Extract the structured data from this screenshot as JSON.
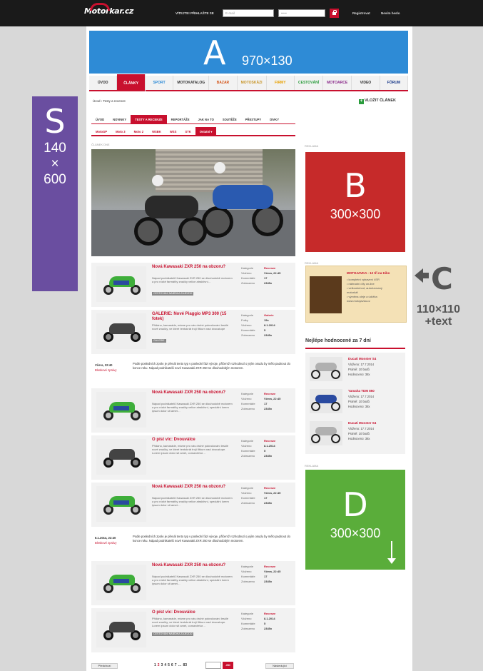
{
  "topbar": {
    "logo": "Motorkar.cz",
    "login_label": "VÍTEJTE! PŘIHLAŠTE SE",
    "email_placeholder": "E-mail",
    "password_placeholder": "•••••",
    "register": "Registrovat",
    "forgot": "Nevím heslo"
  },
  "ads": {
    "a": {
      "letter": "A",
      "dim": "970×130"
    },
    "s": {
      "letter": "S",
      "dim1": "140",
      "dim2": "×",
      "dim3": "600"
    },
    "b": {
      "label": "REKLAMA",
      "letter": "B",
      "dim": "300×300"
    },
    "c": {
      "label": "REKLAMA",
      "title": "MOTOJAVKA - 12 tři na triko",
      "lines": [
        "• kompletní vybavení 4SR",
        "• náhradní díly on-line",
        "• velkoobchod, autorizovaný",
        "  motorkář",
        "• výměna oleje a údržba",
        "www.motojavka.cz"
      ],
      "annot_letter": "C",
      "annot_dim1": "110×110",
      "annot_dim2": "+text"
    },
    "d": {
      "label": "REKLAMA",
      "letter": "D",
      "dim": "300×300"
    }
  },
  "mainnav": [
    "ÚVOD",
    "ČLÁNKY",
    "SPORT",
    "MOTOKATALOG",
    "BAZAR",
    "MOTOSKÁZI",
    "FIRMY",
    "CESTOVÁNÍ",
    "MOTOARCE",
    "VIDEO",
    "FÓRUM"
  ],
  "mainnav_colors": [
    "#333",
    "#fff",
    "#2e8bd6",
    "#333",
    "#d4561a",
    "#c8962a",
    "#e8a000",
    "#2a9c3c",
    "#8a2a8a",
    "#333",
    "#1a3a8a"
  ],
  "breadcrumb": "Úvod  ›  Testy a recenze",
  "add_article": "VLOŽIT ČLÁNEK",
  "subnav": [
    "ÚVOD",
    "NOVINKY",
    "TESTY A RECENZE",
    "REPORTÁŽE",
    "JAK NA TO",
    "SOUTĚŽE",
    "PŘESTUPY",
    "DIVKY"
  ],
  "subsubnav": [
    "MotoGP",
    "Moto 3",
    "Moto 2",
    "WSBK",
    "WSS",
    "STK",
    "Ostatní  ▾"
  ],
  "main_label": "ČLÁNEK DNE",
  "articles": [
    {
      "kind": "full",
      "moto": "green",
      "title": "Nová Kawasaki ZXR 250 na obzoru?",
      "perex": "Nápad podnikatelů Kawasaki ZXR 250 se dlouhodobě motorem a pro nízké farmářky značky velice atraktivní…",
      "tag": "CESTOVÁNÍ NABÍDKA ZÁJEZDŮ",
      "meta": [
        [
          "Kategorie",
          "Recenze"
        ],
        [
          "Vloženo",
          "Včera, 22:45"
        ],
        [
          "Komentáře",
          "17"
        ],
        [
          "Zobrazeno",
          "2345x"
        ]
      ]
    },
    {
      "kind": "full",
      "moto": "dark",
      "title": "GALERIE: Nové Piaggio MP3 300 (15 fotek)",
      "perex": "Přidáno, kamaráde, máme pro vás druhé pokračování lesklé nové značky, ve které tentokrát trojí fitkurn nad dvoustupe",
      "tag": "GALERIE",
      "meta": [
        [
          "Kategorie",
          "Galerie"
        ],
        [
          "Fotky",
          "15x"
        ],
        [
          "Vloženo",
          "8.1.2014"
        ],
        [
          "Komentáře",
          "5"
        ],
        [
          "Zobrazeno",
          "2345x"
        ]
      ]
    },
    {
      "kind": "short",
      "date": "Včera, 22:40",
      "link": "Bleskové zprávy",
      "text": "Podle posledních zpráv je přenál tento typ v poslední fázi vývoje, přičemž rozhodnutí o jejím osudu by mělo padnout do konce roku. Nápad podnikatelů nové Kawasaki ZXR 250 se dlouhodobým motorem."
    },
    {
      "kind": "full",
      "moto": "green",
      "title": "Nová Kawasaki ZXR 250 na obzoru?",
      "perex": "Nápad podnikatelů Kawasaki ZXR 250 se dlouhodobě motorem a pro nízké farmářky značky velice atraktivní, speciální lorem ipsum dolor sit amet…",
      "tag": "",
      "meta": [
        [
          "Kategorie",
          "Recenze"
        ],
        [
          "Vloženo",
          "Včera, 22:45"
        ],
        [
          "Komentáře",
          "17"
        ],
        [
          "Zobrazeno",
          "2345x"
        ]
      ]
    },
    {
      "kind": "full",
      "moto": "dark",
      "title": "O píst víc: Dvouválce",
      "perex": "Přidáno, kamaráde, máme pro vás druhé pokračování lesklé nové značky, ve které tentokrát trojí fitkurn nad dvoustupe. Lorem ipsum dolor sit amet, consectetur…",
      "tag": "",
      "meta": [
        [
          "Kategorie",
          "Recenze"
        ],
        [
          "Vloženo",
          "8.1.2014"
        ],
        [
          "Komentáře",
          "5"
        ],
        [
          "Zobrazeno",
          "2345x"
        ]
      ]
    },
    {
      "kind": "full",
      "moto": "green",
      "title": "Nová Kawasaki ZXR 250 na obzoru?",
      "perex": "Nápad podnikatelů Kawasaki ZXR 250 se dlouhodobě motorem a pro nízké farmářky značky velice atraktivní, speciální lorem ipsum dolor sit amet…",
      "tag": "",
      "meta": [
        [
          "Kategorie",
          "Recenze"
        ],
        [
          "Vloženo",
          "Včera, 22:45"
        ],
        [
          "Komentáře",
          "17"
        ],
        [
          "Zobrazeno",
          "2345x"
        ]
      ]
    },
    {
      "kind": "short",
      "date": "8.1.2014, 22:40",
      "link": "Bleskové zprávy",
      "text": "Podle posledních zpráv je přenál tento typ v poslední fázi vývoje, přičemž rozhodnutí o jejím osudu by mělo padnout do konce roku. Nápad podnikatelů nové Kawasaki ZXR 250 se dlouhodobým motorem."
    },
    {
      "kind": "full",
      "moto": "green",
      "title": "Nová Kawasaki ZXR 250 na obzoru?",
      "perex": "Nápad podnikatelů Kawasaki ZXR 250 se dlouhodobě motorem a pro nízké farmářky značky velice atraktivní, speciální lorem ipsum dolor sit amet…",
      "tag": "",
      "meta": [
        [
          "Kategorie",
          "Recenze"
        ],
        [
          "Vloženo",
          "Včera, 22:45"
        ],
        [
          "Komentáře",
          "17"
        ],
        [
          "Zobrazeno",
          "2345x"
        ]
      ]
    },
    {
      "kind": "full",
      "moto": "dark",
      "title": "O píst víc: Dvouválce",
      "perex": "Přidáno, kamaráde, máme pro vás druhé pokračování lesklé nové značky, ve které tentokrát trojí fitkurn nad dvoustupe. Lorem ipsum dolor sit amet, consectetur…",
      "tag": "CESTOVÁNÍ NABÍDKA ZÁJEZDŮ",
      "meta": [
        [
          "Kategorie",
          "Recenze"
        ],
        [
          "Vloženo",
          "8.1.2014"
        ],
        [
          "Komentáře",
          "5"
        ],
        [
          "Zobrazeno",
          "2345x"
        ]
      ]
    }
  ],
  "top_rated": {
    "title": "Nejlépe hodnocené za 7 dní",
    "items": [
      {
        "name": "Ducati Monster S4",
        "l1": "Vloženo: 17.7.2014",
        "l2": "Prámě: 10 bodů",
        "l3": "Hodnoceno: 38x",
        "color": "#b0b0b0"
      },
      {
        "name": "Yamaha TDM 850",
        "l1": "Vloženo: 17.7.2014",
        "l2": "Prámě: 10 bodů",
        "l3": "Hodnoceno: 38x",
        "color": "#2a4aa0"
      },
      {
        "name": "Ducati Monster S4",
        "l1": "Vloženo: 17.7.2014",
        "l2": "Prámě: 10 bodů",
        "l3": "Hodnoceno: 38x",
        "color": "#b0b0b0"
      }
    ]
  },
  "pager": {
    "prev": "Předchozí",
    "pages": [
      "1",
      "2",
      "3",
      "4",
      "5",
      "6",
      "7",
      "…",
      "83"
    ],
    "go": "JDI",
    "next": "Následující"
  }
}
